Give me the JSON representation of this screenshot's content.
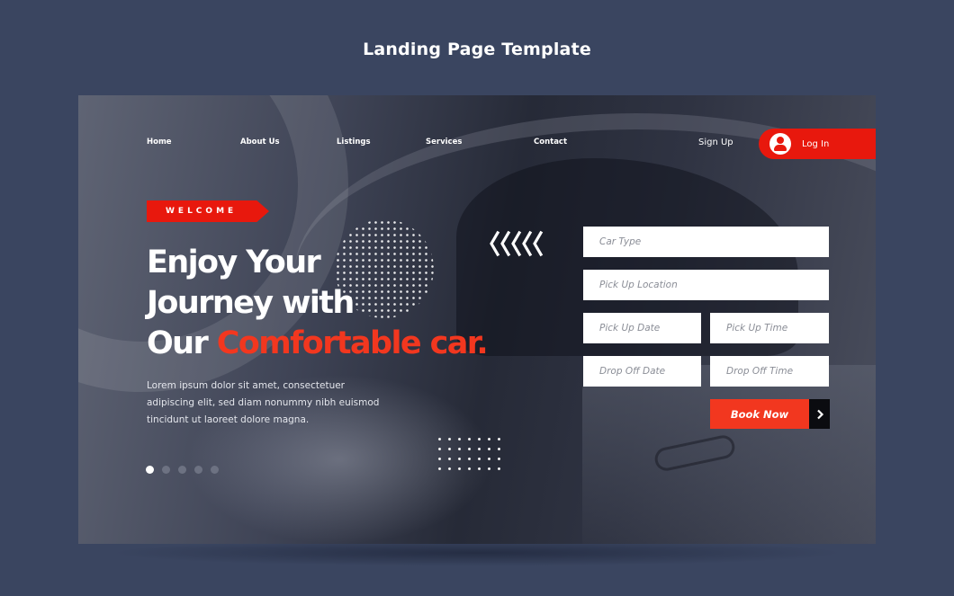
{
  "page": {
    "title": "Landing Page Template"
  },
  "nav": {
    "items": [
      "Home",
      "About Us",
      "Listings",
      "Services",
      "Contact"
    ],
    "signup_label": "Sign Up",
    "login_label": "Log In"
  },
  "hero": {
    "badge": "WELCOME",
    "headline_line1": "Enjoy Your",
    "headline_line2": "Journey with",
    "headline_line3_prefix": "Our ",
    "headline_line3_accent": "Comfortable car.",
    "description": "Lorem ipsum dolor sit amet, consectetuer adipiscing elit, sed diam nonummy nibh euismod tincidunt ut laoreet dolore magna.",
    "slider_total": 5,
    "slider_active": 1
  },
  "booking_form": {
    "car_type_placeholder": "Car Type",
    "pickup_location_placeholder": "Pick Up Location",
    "pickup_date_placeholder": "Pick Up Date",
    "pickup_time_placeholder": "Pick Up Time",
    "dropoff_date_placeholder": "Drop Off Date",
    "dropoff_time_placeholder": "Drop Off Time",
    "submit_label": "Book Now"
  },
  "icons": {
    "login": "user-icon",
    "submit": "chevron-right-icon",
    "decor": "chevrons-left-icon"
  },
  "colors": {
    "accent": "#f2371f",
    "badge_red": "#e8180d",
    "background": "#3a4560"
  }
}
